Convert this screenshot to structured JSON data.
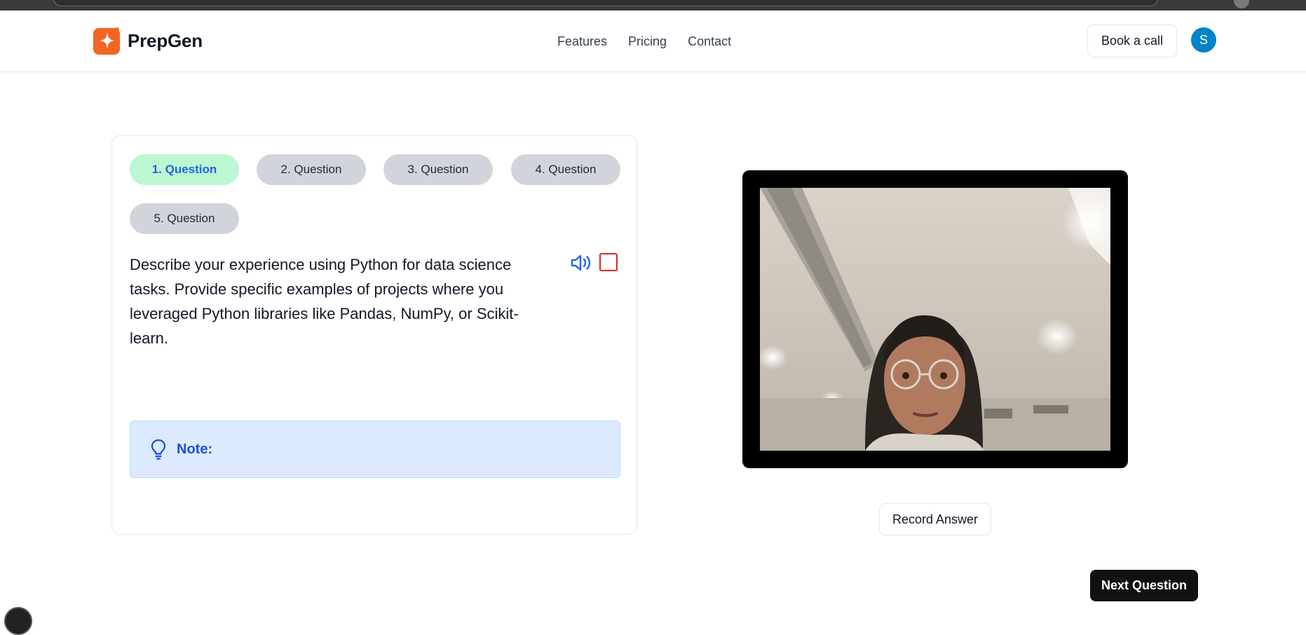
{
  "header": {
    "brand": "PrepGen",
    "nav": [
      "Features",
      "Pricing",
      "Contact"
    ],
    "book_label": "Book a call",
    "avatar_initial": "S"
  },
  "question_panel": {
    "tabs": [
      "1. Question",
      "2. Question",
      "3. Question",
      "4. Question",
      "5. Question"
    ],
    "active_tab": 0,
    "question": "Describe your experience using Python for data science tasks. Provide specific examples of projects where you leveraged Python libraries like Pandas, NumPy, or Scikit-learn.",
    "note_label": "Note:",
    "icons": [
      "speaker-icon",
      "stop-icon",
      "lightbulb-icon"
    ]
  },
  "webcam": {},
  "actions": {
    "record_label": "Record Answer",
    "next_label": "Next Question"
  },
  "colors": {
    "brand_orange": "#f26522",
    "active_tab_bg": "#bbf7d0",
    "active_tab_text": "#2563eb",
    "tab_bg": "#d1d5db",
    "note_bg": "#dbeafe",
    "note_text": "#1d4ed8",
    "avatar_bg": "#0284c7",
    "stop_red": "#dc2626"
  }
}
